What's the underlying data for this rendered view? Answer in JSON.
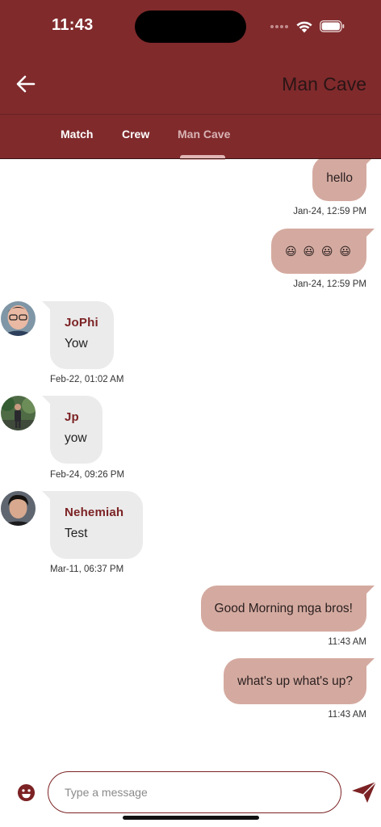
{
  "status_bar": {
    "time": "11:43"
  },
  "header": {
    "title": "Man Cave",
    "back_icon": "arrow-left-icon"
  },
  "tabs": [
    {
      "label": "Match",
      "selected": false
    },
    {
      "label": "Crew",
      "selected": false
    },
    {
      "label": "Man Cave",
      "selected": true
    }
  ],
  "messages": [
    {
      "direction": "out",
      "text": "hello",
      "time": "Jan-24, 12:59 PM"
    },
    {
      "direction": "out",
      "text": "😃 😃 😃 😃",
      "time": "Jan-24, 12:59 PM"
    },
    {
      "direction": "in",
      "sender": "JoPhi",
      "text": "Yow",
      "time": "Feb-22, 01:02 AM"
    },
    {
      "direction": "in",
      "sender": "Jp",
      "text": "yow",
      "time": "Feb-24, 09:26 PM"
    },
    {
      "direction": "in",
      "sender": "Nehemiah",
      "text": "Test",
      "time": "Mar-11, 06:37 PM"
    },
    {
      "direction": "out",
      "text": "Good Morning mga bros!",
      "time": "11:43 AM"
    },
    {
      "direction": "out",
      "text": "what's up what's up?",
      "time": "11:43 AM"
    }
  ],
  "composer": {
    "placeholder": "Type a message",
    "value": ""
  },
  "colors": {
    "primary": "#802a2c",
    "outgoing_bubble": "#d4aaa0",
    "incoming_bubble": "#ebebeb",
    "sender_name": "#7c2224"
  }
}
